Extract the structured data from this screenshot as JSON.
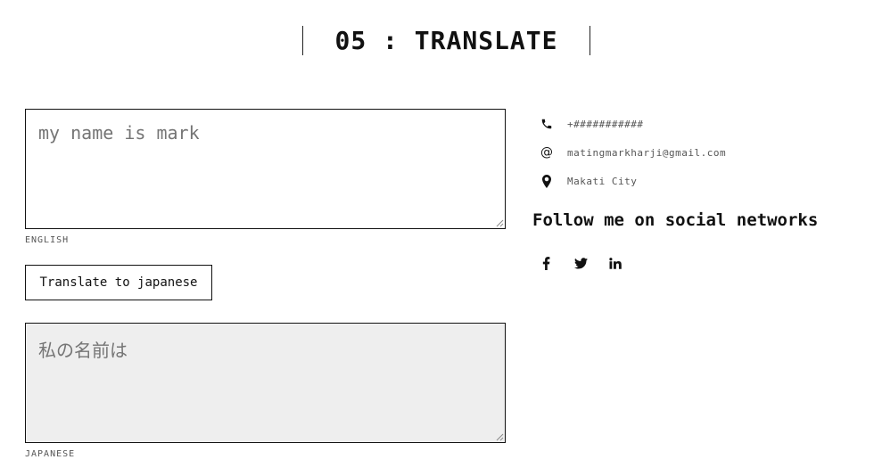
{
  "header": {
    "title": "05 : TRANSLATE"
  },
  "translator": {
    "source": {
      "placeholder": "my name is mark",
      "label": "ENGLISH"
    },
    "translate_button_label": "Translate to japanese",
    "target": {
      "placeholder": "私の名前は",
      "label": "JAPANESE"
    }
  },
  "contact": {
    "phone": {
      "icon": "phone-icon",
      "text": "+###########"
    },
    "email": {
      "icon": "at-icon",
      "text": "matingmarkharji@gmail.com"
    },
    "location": {
      "icon": "map-pin-icon",
      "text": "Makati City"
    }
  },
  "social": {
    "heading": "Follow me on social networks",
    "links": [
      {
        "icon": "facebook-icon"
      },
      {
        "icon": "twitter-icon"
      },
      {
        "icon": "linkedin-icon"
      }
    ]
  }
}
